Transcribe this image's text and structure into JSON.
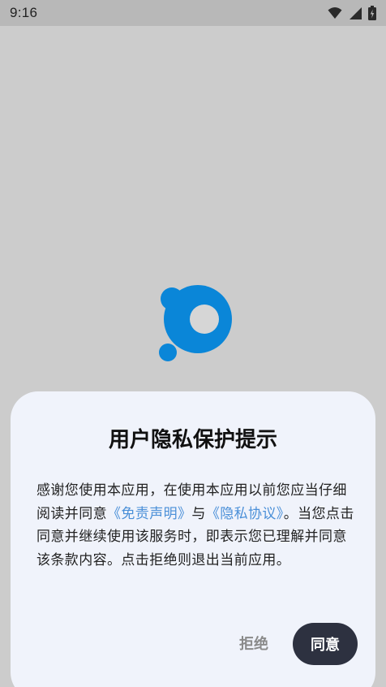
{
  "status_bar": {
    "time": "9:16",
    "icons": [
      "wifi-icon",
      "cellular-signal-icon",
      "battery-charging-icon"
    ]
  },
  "splash": {
    "logo_icon": "app-logo-icon",
    "logo_color": "#0a86d8"
  },
  "dialog": {
    "title": "用户隐私保护提示",
    "body": {
      "intro": "感谢您使用本应用，在使用本应用以前您应当仔细阅读并同意",
      "disclaimer_link": "《免责声明》",
      "connector": "与",
      "privacy_link": "《隐私协议》",
      "outro": "。当您点击同意并继续使用该服务时，即表示您已理解并同意该条款内容。点击拒绝则退出当前应用。"
    },
    "reject_label": "拒绝",
    "agree_label": "同意"
  },
  "colors": {
    "link": "#4a8fd8",
    "agree_button": "#2d3140",
    "dialog_background": "#f0f3fb",
    "overlay": "#cccccc"
  }
}
